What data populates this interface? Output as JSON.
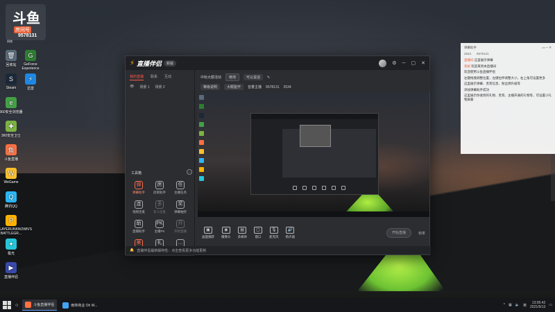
{
  "desktop": {
    "logo": {
      "big": "斗鱼",
      "sub1": "房间号",
      "sub2": "9578131",
      "sub3": "网络"
    },
    "icons": [
      {
        "label": "回收站",
        "color": "#5a6b7a",
        "glyph": "🗑"
      },
      {
        "label": "GeForce Experience",
        "color": "#2e7d32",
        "glyph": "G"
      },
      {
        "label": "Steam",
        "color": "#1b2838",
        "glyph": "S"
      },
      {
        "label": "迅雷",
        "color": "#1e88e5",
        "glyph": "⚡"
      },
      {
        "label": "360安全浏览器",
        "color": "#43a047",
        "glyph": "e"
      },
      {
        "label": "360安全卫士",
        "color": "#7cb342",
        "glyph": "✚"
      },
      {
        "label": "斗鱼直播",
        "color": "#ff7043",
        "glyph": "鱼"
      },
      {
        "label": "WeGame",
        "color": "#fbc02d",
        "glyph": "W"
      },
      {
        "label": "腾讯QQ",
        "color": "#29b6f6",
        "glyph": "Q"
      },
      {
        "label": "PLAYERUNKNOWN'S BATTLEGR...",
        "color": "#ffb300",
        "glyph": "P"
      },
      {
        "label": "极光",
        "color": "#26c6da",
        "glyph": "✦"
      },
      {
        "label": "直播伴侣",
        "color": "#3949ab",
        "glyph": "▶"
      }
    ]
  },
  "app": {
    "title": "直播伴侣",
    "version": "新版",
    "tabs": [
      "我的直播",
      "联系",
      "互动"
    ],
    "active_tab": "我的直播",
    "scene_row": [
      "场景 1",
      "场景 2"
    ],
    "info": {
      "room_title": "中秋大额活动",
      "category": "绝地",
      "edit_label": "可以说话",
      "row2": [
        "等级说明",
        "大概能开",
        "音量主播",
        "9578131",
        "2534"
      ]
    },
    "tools_title": "工具箱",
    "tools": [
      {
        "label": "弹幕助手",
        "glyph": "弹",
        "style": "red"
      },
      {
        "label": "房管助手",
        "glyph": "房",
        "style": ""
      },
      {
        "label": "主播任务",
        "glyph": "任",
        "style": ""
      },
      {
        "label": "视频连麦",
        "glyph": "连",
        "style": ""
      },
      {
        "label": "多人连麦",
        "glyph": "多",
        "style": "dim"
      },
      {
        "label": "弹幕抽奖",
        "glyph": "奖",
        "style": ""
      },
      {
        "label": "直播助手",
        "glyph": "助",
        "style": ""
      },
      {
        "label": "主播PK",
        "glyph": "PK",
        "style": ""
      },
      {
        "label": "开始直播",
        "glyph": "开",
        "style": "dim"
      },
      {
        "label": "美颜",
        "glyph": "美",
        "style": "red"
      },
      {
        "label": "礼物",
        "glyph": "礼",
        "style": ""
      },
      {
        "label": "更多",
        "glyph": "…",
        "style": ""
      }
    ],
    "notice": "直播伴侣最新版特性：点击查看更多功能更新",
    "controls": [
      {
        "label": "画面捕获",
        "glyph": "▣"
      },
      {
        "label": "摄像头",
        "glyph": "◉"
      },
      {
        "label": "多媒体",
        "glyph": "▤"
      },
      {
        "label": "窗口",
        "glyph": "▢"
      },
      {
        "label": "麦克风",
        "glyph": "🎙"
      },
      {
        "label": "扬声器",
        "glyph": "🔊"
      }
    ],
    "go_live": "开始直播",
    "bottom_right": "帧率"
  },
  "chat": {
    "title": "弹幕助手",
    "stats": [
      "2534",
      "9578131"
    ],
    "messages": [
      {
        "name": "直播间",
        "text": "这里展示弹幕"
      },
      {
        "name": "系统",
        "text": "欢迎来到本直播间"
      },
      {
        "name": "",
        "text": "欢迎使用斗鱼直播伴侣"
      },
      {
        "name": "",
        "text": "左键拖拽调整位置，左键拉伸调整大小，右上角可设置更多"
      },
      {
        "name": "",
        "text": "这里展示弹幕、贵宾信息、粉丝牌升级等"
      },
      {
        "name": "",
        "text": "添加弹幕助手成功"
      },
      {
        "name": "",
        "text": "这里展示你收到的礼物、贵宾、主播开通的礼物等，可设置小礼物屏蔽"
      }
    ]
  },
  "taskbar": {
    "items": [
      {
        "label": "斗鱼直播伴侣",
        "color": "#ff7043"
      },
      {
        "label": "雨林商业 Oh W...",
        "color": "#42a5f5"
      }
    ],
    "tray": [
      "英",
      "ENG"
    ],
    "time": "13:05:42",
    "date": "2021/9/13"
  }
}
